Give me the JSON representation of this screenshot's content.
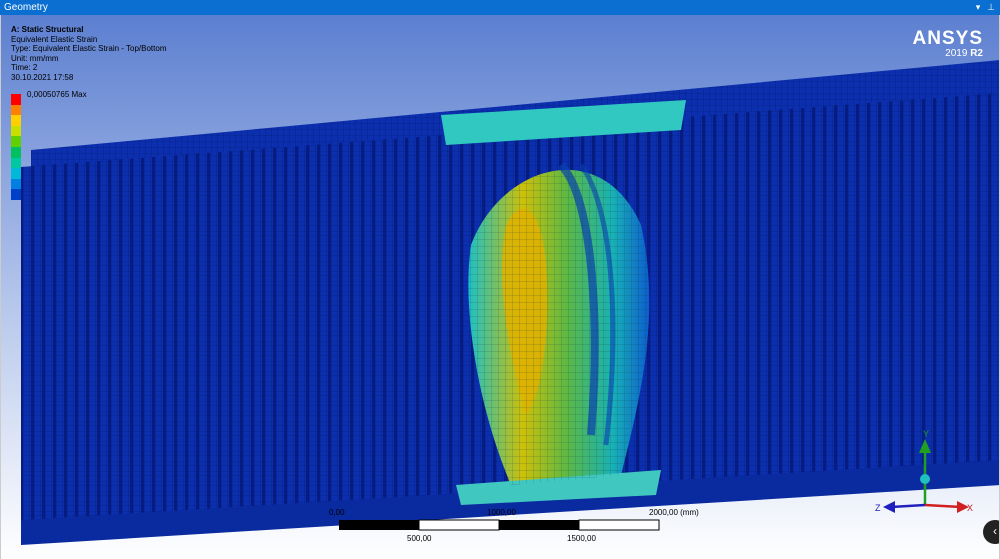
{
  "window": {
    "title": "Geometry",
    "pin_icon": "pin-icon",
    "dropdown_icon": "chevron-down-icon"
  },
  "result": {
    "analysis": "A: Static Structural",
    "name": "Equivalent Elastic Strain",
    "type": "Type: Equivalent Elastic Strain - Top/Bottom",
    "unit": "Unit: mm/mm",
    "time": "Time: 2",
    "date": "30.10.2021 17:58"
  },
  "legend": {
    "max_label": "0,00050765 Max",
    "colors": [
      "#ff0000",
      "#ff8000",
      "#ffd000",
      "#c8e000",
      "#60d000",
      "#00c060",
      "#00c8a0",
      "#00b8d8",
      "#0080e0",
      "#0040c8"
    ]
  },
  "logo": {
    "brand": "ANSYS",
    "version": "2019",
    "release": "R2"
  },
  "scale": {
    "tick_0": "0,00",
    "tick_1000": "1000,00",
    "tick_2000": "2000,00 (mm)",
    "tick_500": "500,00",
    "tick_1500": "1500,00"
  },
  "triad": {
    "x_label": "X",
    "y_label": "Y",
    "z_label": "Z"
  },
  "colors": {
    "titlebar": "#0a6fd0",
    "mesh_blue": "#0c2fb0",
    "background_top": "#7a9ad8"
  }
}
